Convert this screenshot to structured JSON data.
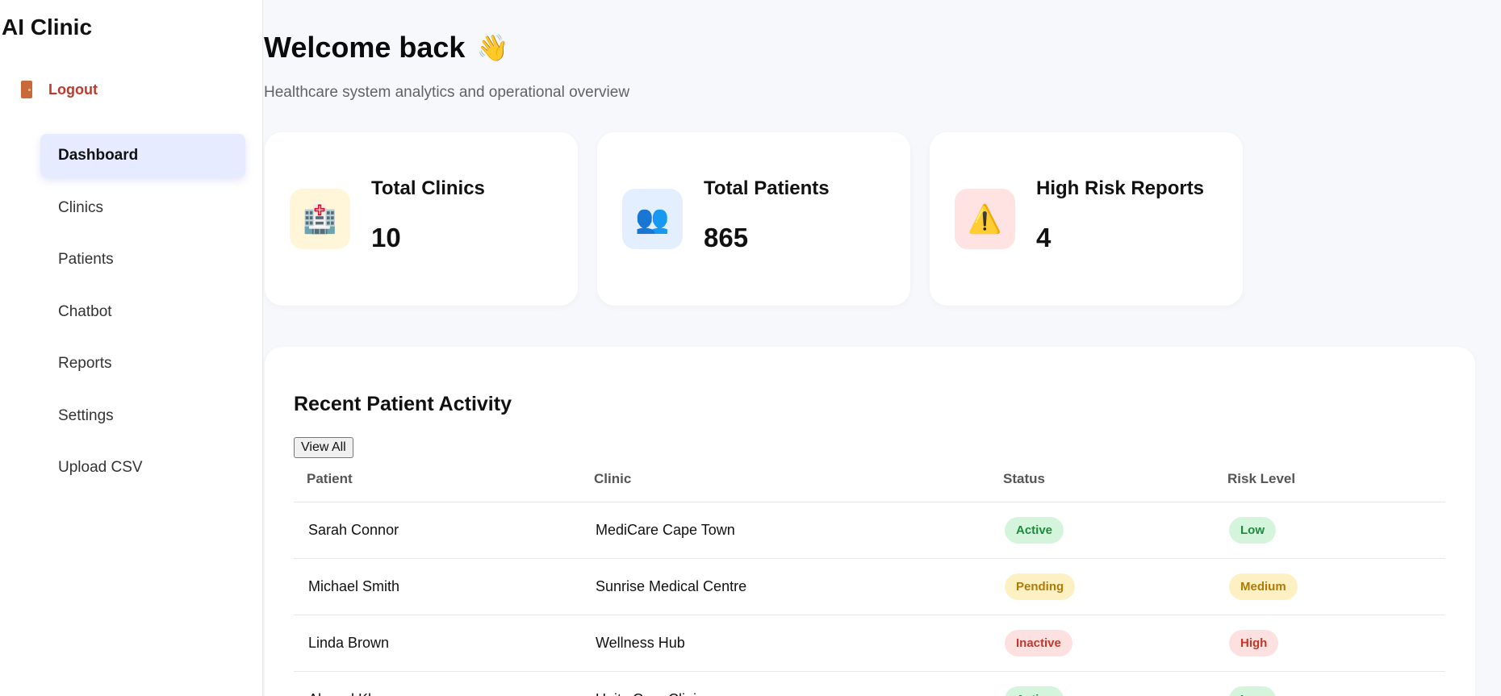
{
  "sidebar": {
    "brand": "AI Clinic",
    "logout_label": "Logout",
    "items": [
      {
        "label": "Dashboard",
        "active": true
      },
      {
        "label": "Clinics"
      },
      {
        "label": "Patients"
      },
      {
        "label": "Chatbot"
      },
      {
        "label": "Reports"
      },
      {
        "label": "Settings"
      },
      {
        "label": "Upload CSV"
      }
    ]
  },
  "header": {
    "title": "Welcome back",
    "title_emoji": "👋",
    "subtitle": "Healthcare system analytics and operational overview"
  },
  "stats": [
    {
      "label": "Total Clinics",
      "value": "10",
      "icon": "🏥",
      "icon_name": "hospital-icon",
      "bg": "#fff6d9"
    },
    {
      "label": "Total Patients",
      "value": "865",
      "icon": "👥",
      "icon_name": "people-icon",
      "bg": "#e3efff"
    },
    {
      "label": "High Risk Reports",
      "value": "4",
      "icon": "⚠️",
      "icon_name": "warning-icon",
      "bg": "#ffe3e3"
    }
  ],
  "activity": {
    "title": "Recent Patient Activity",
    "view_all_label": "View All",
    "columns": [
      "Patient",
      "Clinic",
      "Status",
      "Risk Level"
    ],
    "rows": [
      {
        "patient": "Sarah Connor",
        "clinic": "MediCare Cape Town",
        "status": "Active",
        "risk": "Low"
      },
      {
        "patient": "Michael Smith",
        "clinic": "Sunrise Medical Centre",
        "status": "Pending",
        "risk": "Medium"
      },
      {
        "patient": "Linda Brown",
        "clinic": "Wellness Hub",
        "status": "Inactive",
        "risk": "High"
      },
      {
        "patient": "Ahmed Khan",
        "clinic": "Unity Care Clinic",
        "status": "Active",
        "risk": "Low"
      }
    ]
  },
  "badge_colors": {
    "Active": {
      "bg": "#d4f5dc",
      "fg": "#1e8a3c"
    },
    "Low": {
      "bg": "#d4f5dc",
      "fg": "#1e8a3c"
    },
    "Pending": {
      "bg": "#fdf0c2",
      "fg": "#b07a06"
    },
    "Medium": {
      "bg": "#fdf0c2",
      "fg": "#b07a06"
    },
    "Inactive": {
      "bg": "#fde0e0",
      "fg": "#c0392b"
    },
    "High": {
      "bg": "#fde0e0",
      "fg": "#c0392b"
    }
  }
}
